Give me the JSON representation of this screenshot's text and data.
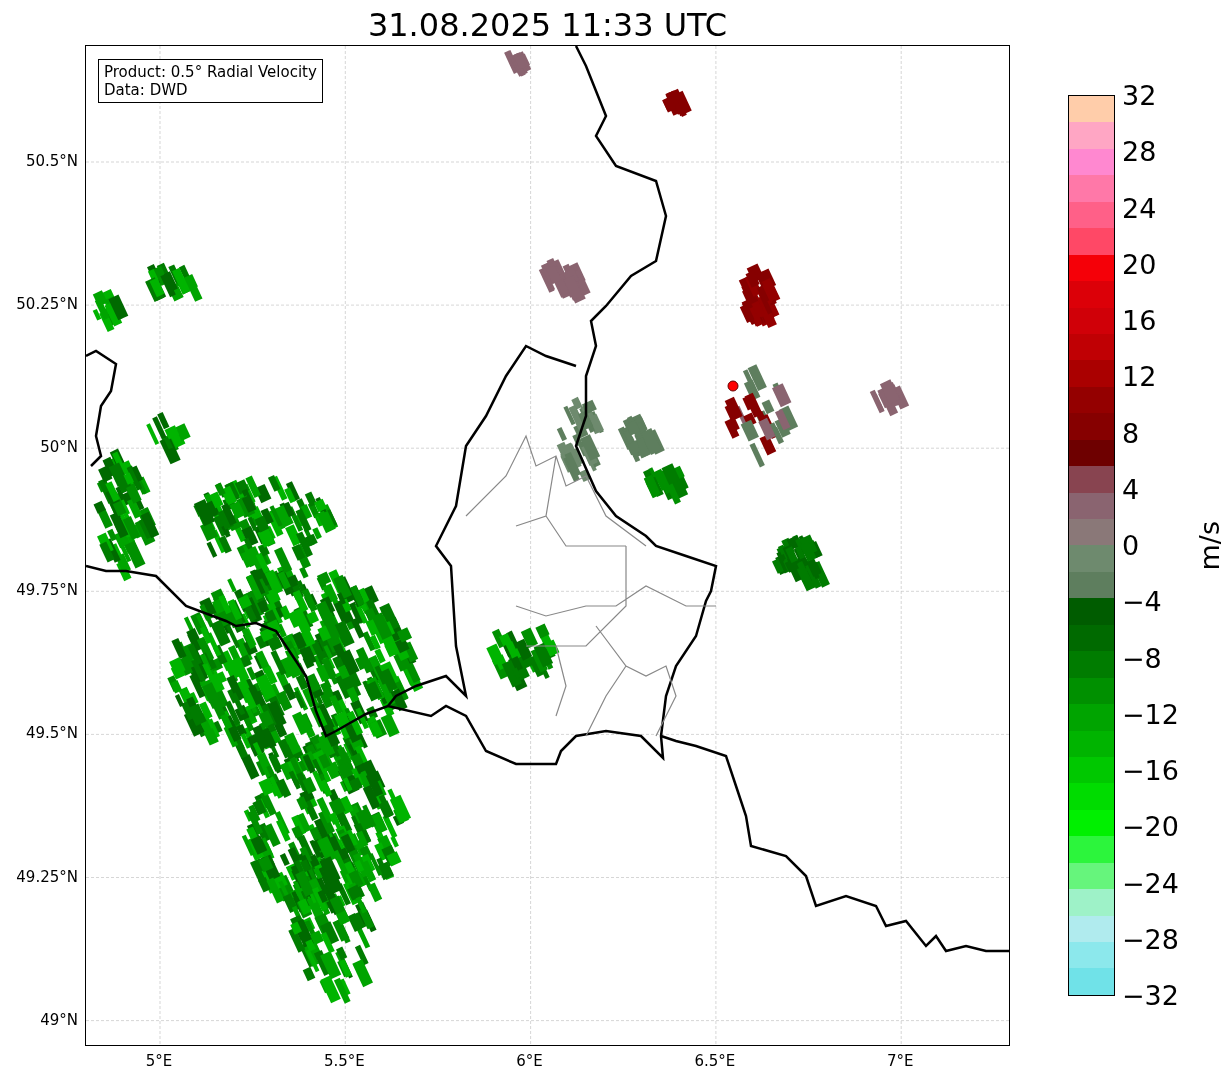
{
  "title": "31.08.2025 11:33 UTC",
  "info_box": {
    "lines": [
      "Product: 0.5° Radial Velocity",
      "Data: DWD"
    ]
  },
  "map": {
    "x_ticks": [
      "5°E",
      "5.5°E",
      "6°E",
      "6.5°E",
      "7°E"
    ],
    "y_ticks": [
      "50.5°N",
      "50.25°N",
      "50°N",
      "49.75°N",
      "49.5°N",
      "49.25°N",
      "49°N"
    ]
  },
  "colorbar": {
    "label": "m/s",
    "ticks": [
      "32",
      "28",
      "24",
      "20",
      "16",
      "12",
      "8",
      "4",
      "0",
      "−4",
      "−8",
      "−12",
      "−16",
      "−20",
      "−24",
      "−28",
      "−32"
    ],
    "bands": [
      {
        "color": "#ffcdaa"
      },
      {
        "color": "#ffa6c4"
      },
      {
        "color": "#ff88d0"
      },
      {
        "color": "#ff78a8"
      },
      {
        "color": "#ff6088"
      },
      {
        "color": "#ff4866"
      },
      {
        "color": "#f50008"
      },
      {
        "color": "#dc0008"
      },
      {
        "color": "#d00008"
      },
      {
        "color": "#c00004"
      },
      {
        "color": "#aa0000"
      },
      {
        "color": "#940000"
      },
      {
        "color": "#860000"
      },
      {
        "color": "#6e0000"
      },
      {
        "color": "#884450"
      },
      {
        "color": "#8a6470"
      },
      {
        "color": "#8a7878"
      },
      {
        "color": "#6e8a6e"
      },
      {
        "color": "#5e7e5e"
      },
      {
        "color": "#005c00"
      },
      {
        "color": "#006a00"
      },
      {
        "color": "#007c00"
      },
      {
        "color": "#009000"
      },
      {
        "color": "#00a400"
      },
      {
        "color": "#00b400"
      },
      {
        "color": "#00c800"
      },
      {
        "color": "#00dc00"
      },
      {
        "color": "#00f000"
      },
      {
        "color": "#2cf53c"
      },
      {
        "color": "#66f57c"
      },
      {
        "color": "#9ef2c8"
      },
      {
        "color": "#b0ebee"
      },
      {
        "color": "#8ce8ec"
      },
      {
        "color": "#70e2e8"
      }
    ]
  }
}
